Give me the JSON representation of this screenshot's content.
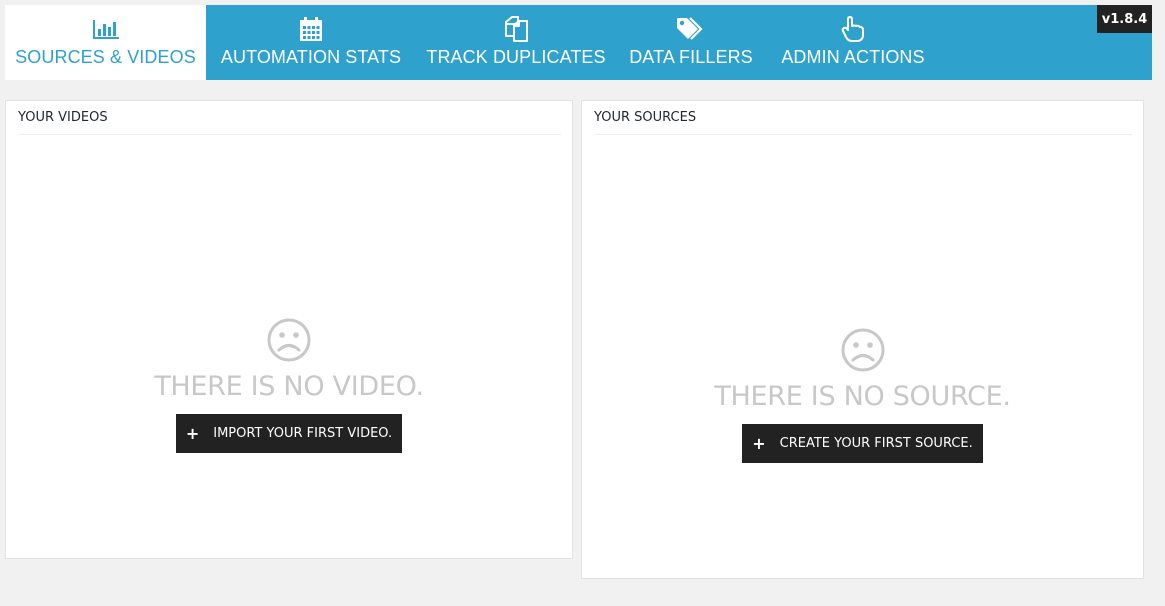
{
  "nav": {
    "tabs": [
      {
        "label": "SOURCES & VIDEOS",
        "icon": "bar-chart-icon",
        "active": true
      },
      {
        "label": "AUTOMATION STATS",
        "icon": "calendar-icon",
        "active": false
      },
      {
        "label": "TRACK DUPLICATES",
        "icon": "copy-icon",
        "active": false
      },
      {
        "label": "DATA FILLERS",
        "icon": "tags-icon",
        "active": false
      },
      {
        "label": "ADMIN ACTIONS",
        "icon": "hand-pointer-icon",
        "active": false
      }
    ],
    "version": "v1.8.4"
  },
  "colors": {
    "accent": "#2ea2cc",
    "button": "#222222",
    "muted_text": "#c8c8c8",
    "background": "#f1f1f1"
  },
  "videos_panel": {
    "title": "YOUR VIDEOS",
    "empty_icon": "sad-face-icon",
    "empty_message": "THERE IS NO VIDEO.",
    "button_label": "IMPORT YOUR FIRST VIDEO."
  },
  "sources_panel": {
    "title": "YOUR SOURCES",
    "empty_icon": "sad-face-icon",
    "empty_message": "THERE IS NO SOURCE.",
    "button_label": "CREATE YOUR FIRST SOURCE."
  }
}
